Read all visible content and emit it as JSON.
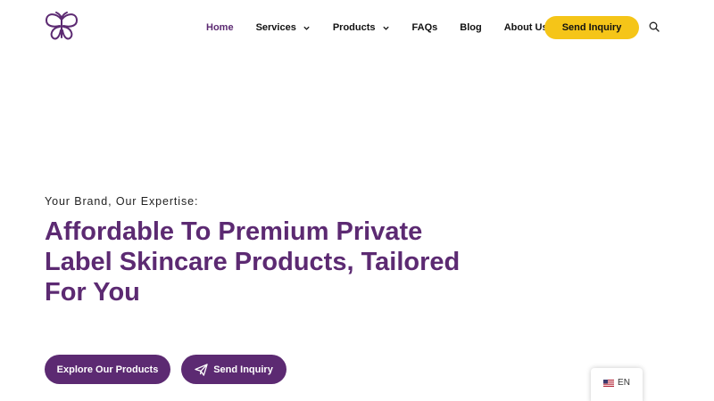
{
  "header": {
    "logo_icon": "butterfly-logo-icon",
    "nav": [
      {
        "label": "Home",
        "active": true,
        "has_dropdown": false
      },
      {
        "label": "Services",
        "active": false,
        "has_dropdown": true
      },
      {
        "label": "Products",
        "active": false,
        "has_dropdown": true
      },
      {
        "label": "FAQs",
        "active": false,
        "has_dropdown": false
      },
      {
        "label": "Blog",
        "active": false,
        "has_dropdown": false
      },
      {
        "label": "About Us",
        "active": false,
        "has_dropdown": true
      }
    ],
    "cta_label": "Send Inquiry",
    "search_icon": "search-icon"
  },
  "hero": {
    "kicker": "Your Brand, Our Expertise:",
    "title": "Affordable To Premium Private Label Skincare Products, Tailored For You",
    "buttons": {
      "explore_label": "Explore Our Products",
      "send_label": "Send Inquiry",
      "send_icon": "paper-plane-icon"
    }
  },
  "language": {
    "flag_icon": "us-flag-icon",
    "label": "EN"
  },
  "colors": {
    "brand_purple": "#5c2a72",
    "accent_yellow": "#f5c518",
    "text_dark": "#111111"
  }
}
